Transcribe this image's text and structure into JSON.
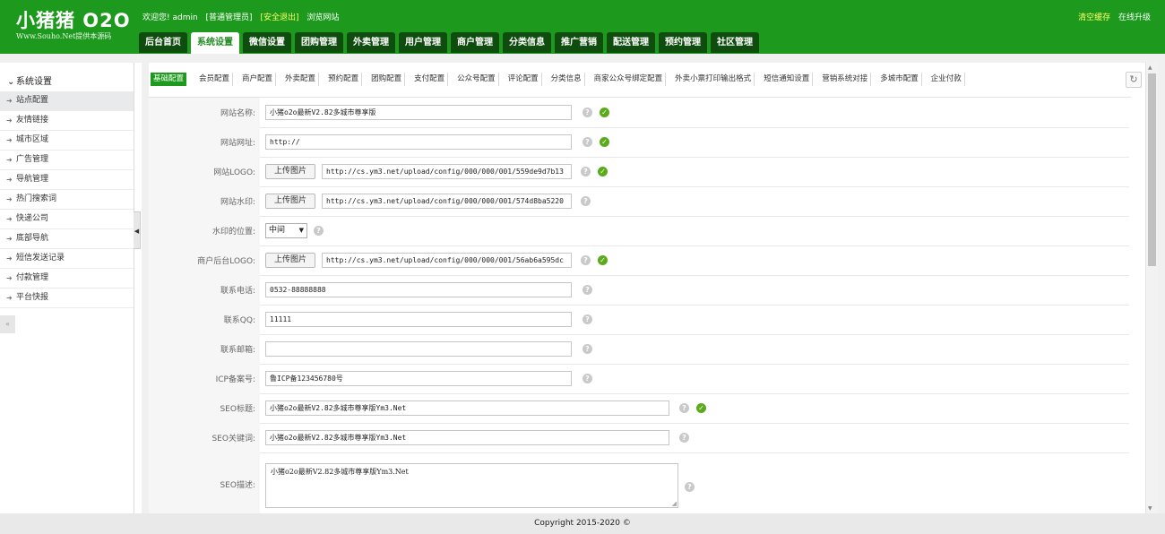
{
  "header": {
    "logo_title": "小猪猪 O2O",
    "logo_sub": "Www.Souho.Net提供本源码",
    "welcome": "欢迎您! admin",
    "role": "[普通管理员]",
    "logout": "[安全退出]",
    "browse": "浏览网站",
    "clear_cache": "清空缓存",
    "online_upgrade": "在线升级"
  },
  "nav": {
    "tabs": [
      "后台首页",
      "系统设置",
      "微信设置",
      "团购管理",
      "外卖管理",
      "用户管理",
      "商户管理",
      "分类信息",
      "推广营销",
      "配送管理",
      "预约管理",
      "社区管理"
    ],
    "active": "系统设置"
  },
  "sidebar": {
    "title": "系统设置",
    "items": [
      "站点配置",
      "友情链接",
      "城市区域",
      "广告管理",
      "导航管理",
      "热门搜索词",
      "快递公司",
      "底部导航",
      "短信发送记录",
      "付款管理",
      "平台快报"
    ],
    "active": "站点配置"
  },
  "subtabs": [
    "基础配置",
    "会员配置",
    "商户配置",
    "外卖配置",
    "预约配置",
    "团购配置",
    "支付配置",
    "公众号配置",
    "评论配置",
    "分类信息",
    "商家公众号绑定配置",
    "外卖小票打印输出格式",
    "短信通知设置",
    "营销系统对接",
    "多城市配置",
    "企业付款"
  ],
  "form": {
    "upload_label": "上传图片",
    "site_name": {
      "label": "网站名称:",
      "value": "小猪o2o最新V2.82多城市尊享版"
    },
    "site_url": {
      "label": "网站网址:",
      "value": "http://"
    },
    "site_logo": {
      "label": "网站LOGO:",
      "value": "http://cs.ym3.net/upload/config/000/000/001/559de9d7b13"
    },
    "site_watermark": {
      "label": "网站水印:",
      "value": "http://cs.ym3.net/upload/config/000/000/001/574d8ba5220"
    },
    "watermark_pos": {
      "label": "水印的位置:",
      "value": "中间"
    },
    "merchant_logo": {
      "label": "商户后台LOGO:",
      "value": "http://cs.ym3.net/upload/config/000/000/001/56ab6a595dc"
    },
    "phone": {
      "label": "联系电话:",
      "value": "0532-88888888"
    },
    "qq": {
      "label": "联系QQ:",
      "value": "11111"
    },
    "email": {
      "label": "联系邮箱:",
      "value": ""
    },
    "icp": {
      "label": "ICP备案号:",
      "value": "鲁ICP备123456780号"
    },
    "seo_title": {
      "label": "SEO标题:",
      "value": "小猪o2o最新V2.82多城市尊享版Ym3.Net"
    },
    "seo_keywords": {
      "label": "SEO关键词:",
      "value": "小猪o2o最新V2.82多城市尊享版Ym3.Net"
    },
    "seo_desc": {
      "label": "SEO描述:",
      "value": "小猪o2o最新V2.82多城市尊享版Ym3.Net"
    }
  },
  "footer": {
    "copyright": "Copyright 2015-2020 ©"
  }
}
